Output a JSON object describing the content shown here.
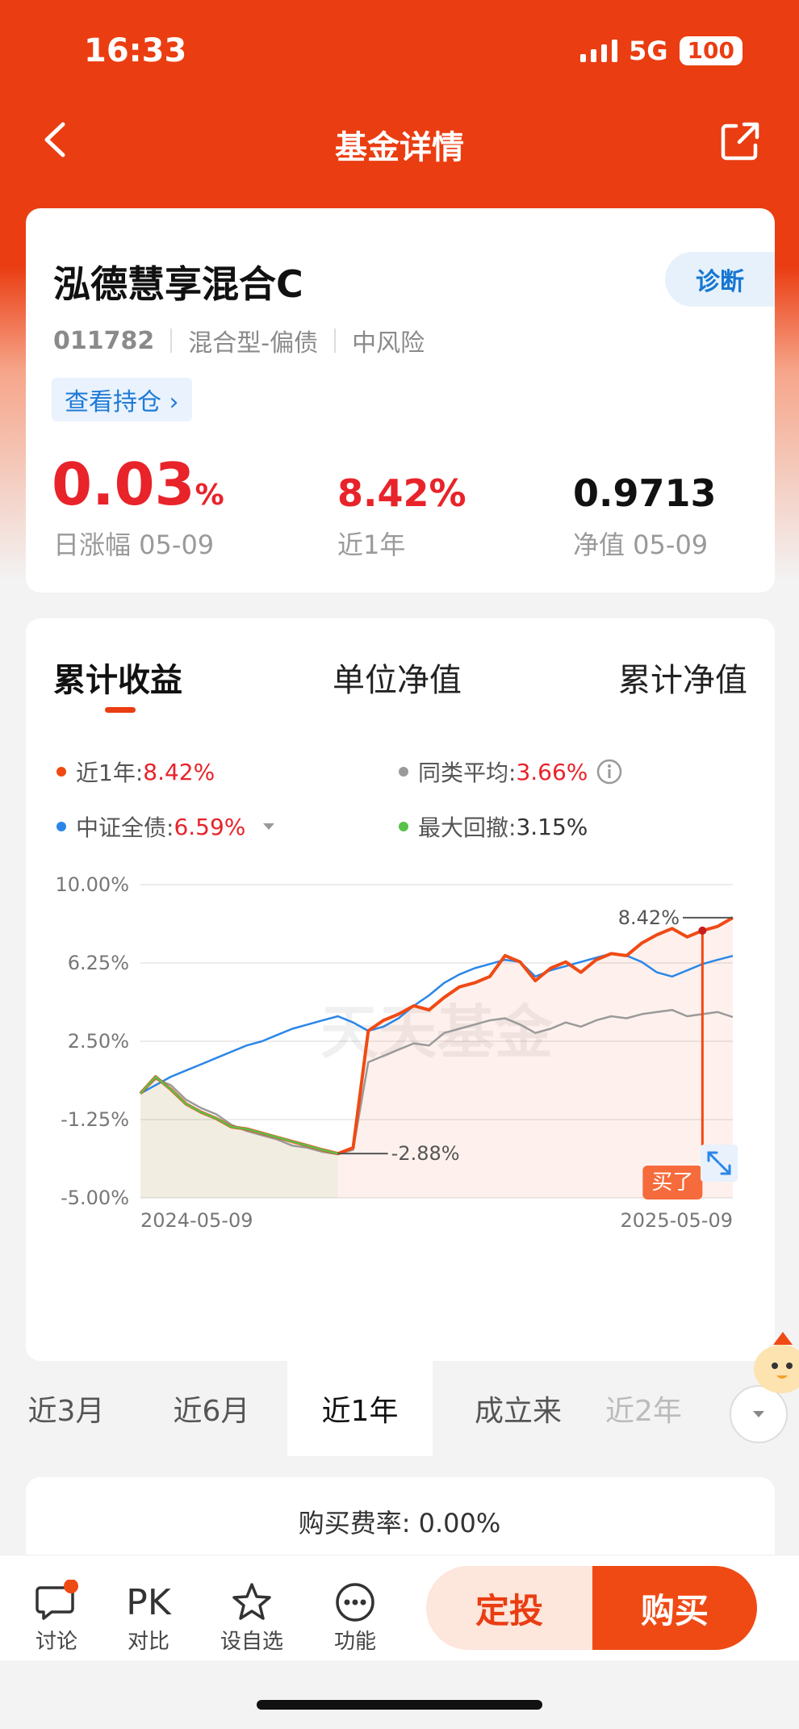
{
  "status": {
    "time": "16:33",
    "network": "5G",
    "battery": "100"
  },
  "header": {
    "title": "基金详情"
  },
  "fund": {
    "name": "泓德慧享混合C",
    "code": "011782",
    "type": "混合型-偏债",
    "risk": "中风险",
    "diagnose_label": "诊断",
    "holdings_label": "查看持仓 ›",
    "daily_change": "0.03",
    "daily_change_unit": "%",
    "daily_label": "日涨幅 05-09",
    "year_return": "8.42%",
    "year_label": "近1年",
    "nav": "0.9713",
    "nav_label": "净值 05-09"
  },
  "chart_tabs": [
    "累计收益",
    "单位净值",
    "累计净值"
  ],
  "legend": [
    {
      "label": "近1年:",
      "value": "8.42%",
      "color": "#f04a14",
      "value_red": true
    },
    {
      "label": "同类平均:",
      "value": "3.66%",
      "color": "#9a9a9a",
      "value_red": true
    },
    {
      "label": "中证全债:",
      "value": "6.59%",
      "color": "#2b86e8",
      "value_red": true
    },
    {
      "label": "最大回撤:",
      "value": "3.15%",
      "color": "#58c24b",
      "value_red": false
    }
  ],
  "chart_data": {
    "type": "line",
    "y_ticks": [
      "10.00%",
      "6.25%",
      "2.50%",
      "-1.25%",
      "-5.00%"
    ],
    "ylim": [
      -5,
      10
    ],
    "x_start": "2024-05-09",
    "x_end": "2025-05-09",
    "annotations": {
      "high": "8.42%",
      "low": "-2.88%",
      "buy": "买了"
    },
    "watermark": "天天基金",
    "series": [
      {
        "name": "近1年",
        "color": "#f04a14",
        "values": [
          0.0,
          0.8,
          0.2,
          -0.5,
          -0.9,
          -1.2,
          -1.6,
          -1.7,
          -1.9,
          -2.1,
          -2.3,
          -2.5,
          -2.7,
          -2.88,
          -2.6,
          3.0,
          3.5,
          3.8,
          4.2,
          4.0,
          4.6,
          5.1,
          5.3,
          5.6,
          6.6,
          6.3,
          5.4,
          6.0,
          6.3,
          5.8,
          6.4,
          6.7,
          6.6,
          7.2,
          7.6,
          7.9,
          7.5,
          7.8,
          8.0,
          8.42
        ]
      },
      {
        "name": "同类平均",
        "color": "#9a9a9a",
        "values": [
          0.0,
          0.7,
          0.4,
          -0.3,
          -0.7,
          -1.0,
          -1.5,
          -1.8,
          -2.0,
          -2.2,
          -2.5,
          -2.6,
          -2.8,
          -2.9,
          -2.7,
          1.5,
          1.8,
          2.1,
          2.4,
          2.3,
          2.9,
          3.1,
          3.3,
          3.5,
          3.6,
          3.3,
          2.9,
          3.1,
          3.4,
          3.2,
          3.5,
          3.7,
          3.6,
          3.8,
          3.9,
          4.0,
          3.7,
          3.8,
          3.9,
          3.66
        ]
      },
      {
        "name": "中证全债",
        "color": "#2b86e8",
        "values": [
          0.0,
          0.4,
          0.8,
          1.1,
          1.4,
          1.7,
          2.0,
          2.3,
          2.5,
          2.8,
          3.1,
          3.3,
          3.5,
          3.7,
          3.4,
          3.0,
          3.2,
          3.6,
          4.2,
          4.7,
          5.3,
          5.7,
          6.0,
          6.2,
          6.4,
          6.3,
          5.6,
          5.9,
          6.1,
          6.3,
          6.5,
          6.7,
          6.6,
          6.3,
          5.8,
          5.6,
          5.9,
          6.2,
          6.4,
          6.59
        ]
      },
      {
        "name": "最大回撤",
        "color": "#58c24b",
        "values": [
          0.0,
          0.8,
          0.2,
          -0.5,
          -0.9,
          -1.2,
          -1.6,
          -1.7,
          -1.9,
          -2.1,
          -2.3,
          -2.5,
          -2.7,
          -2.88
        ]
      }
    ]
  },
  "periods": [
    "近3月",
    "近6月",
    "近1年",
    "成立来",
    "近2年"
  ],
  "active_period": 2,
  "fee_text": "购买费率: 0.00%",
  "bottom_bar": {
    "discuss": "讨论",
    "compare": "对比",
    "compare_icon": "PK",
    "watch": "设自选",
    "func": "功能",
    "dt": "定投",
    "buy": "购买"
  }
}
